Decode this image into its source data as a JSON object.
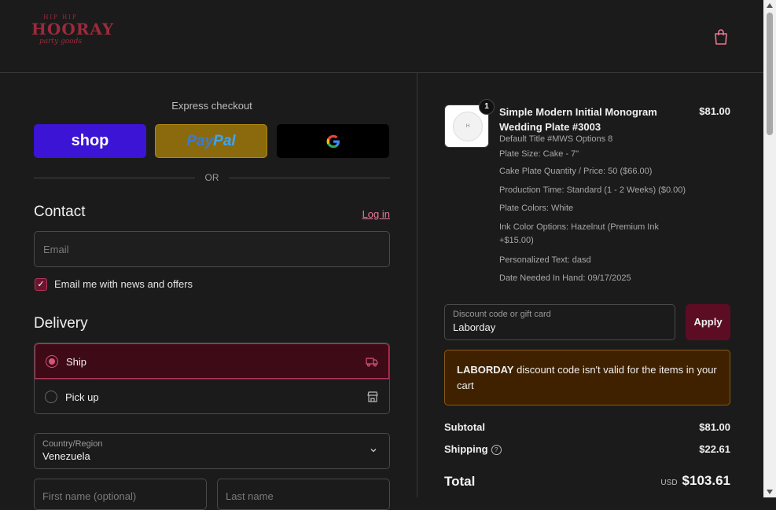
{
  "header": {
    "logo": {
      "top": "HIP HIP",
      "main": "HOORAY",
      "sub": "party goods"
    },
    "cart_icon": "shopping-bag-icon"
  },
  "express": {
    "title": "Express checkout",
    "shop_label": "shop",
    "paypal_pay": "Pay",
    "paypal_pal": "Pal",
    "gpay_icon": "google-icon",
    "or_label": "OR"
  },
  "contact": {
    "title": "Contact",
    "login_label": "Log in",
    "email_placeholder": "Email",
    "newsletter_label": "Email me with news and offers",
    "newsletter_checked": true
  },
  "delivery": {
    "title": "Delivery",
    "options": [
      {
        "label": "Ship",
        "selected": true,
        "icon": "truck-icon"
      },
      {
        "label": "Pick up",
        "selected": false,
        "icon": "store-icon"
      }
    ],
    "country_label": "Country/Region",
    "country_value": "Venezuela",
    "first_name_placeholder": "First name (optional)",
    "last_name_placeholder": "Last name"
  },
  "order": {
    "item": {
      "quantity": "1",
      "title": "Simple Modern Initial Monogram Wedding Plate #3003",
      "price": "$81.00",
      "properties": [
        "Default Title #MWS Options 8",
        "Plate Size: Cake - 7\"",
        "Cake Plate Quantity / Price: 50 ($66.00)",
        "Production Time: Standard (1 - 2 Weeks) ($0.00)",
        "Plate Colors: White",
        "Ink Color Options: Hazelnut (Premium Ink +$15.00)",
        "Personalized Text: dasd",
        "Date Needed In Hand: 09/17/2025"
      ]
    },
    "discount": {
      "label": "Discount code or gift card",
      "value": "Laborday",
      "apply_label": "Apply"
    },
    "alert": {
      "code": "LABORDAY",
      "message": " discount code isn't valid for the items in your cart"
    },
    "subtotal_label": "Subtotal",
    "subtotal_value": "$81.00",
    "shipping_label": "Shipping",
    "shipping_value": "$22.61",
    "total_label": "Total",
    "currency": "USD",
    "total_value": "$103.61"
  },
  "colors": {
    "accent": "#b5345a",
    "shop": "#3b14d6",
    "paypal": "#8a6a0c",
    "alert_bg": "#3f2100"
  }
}
